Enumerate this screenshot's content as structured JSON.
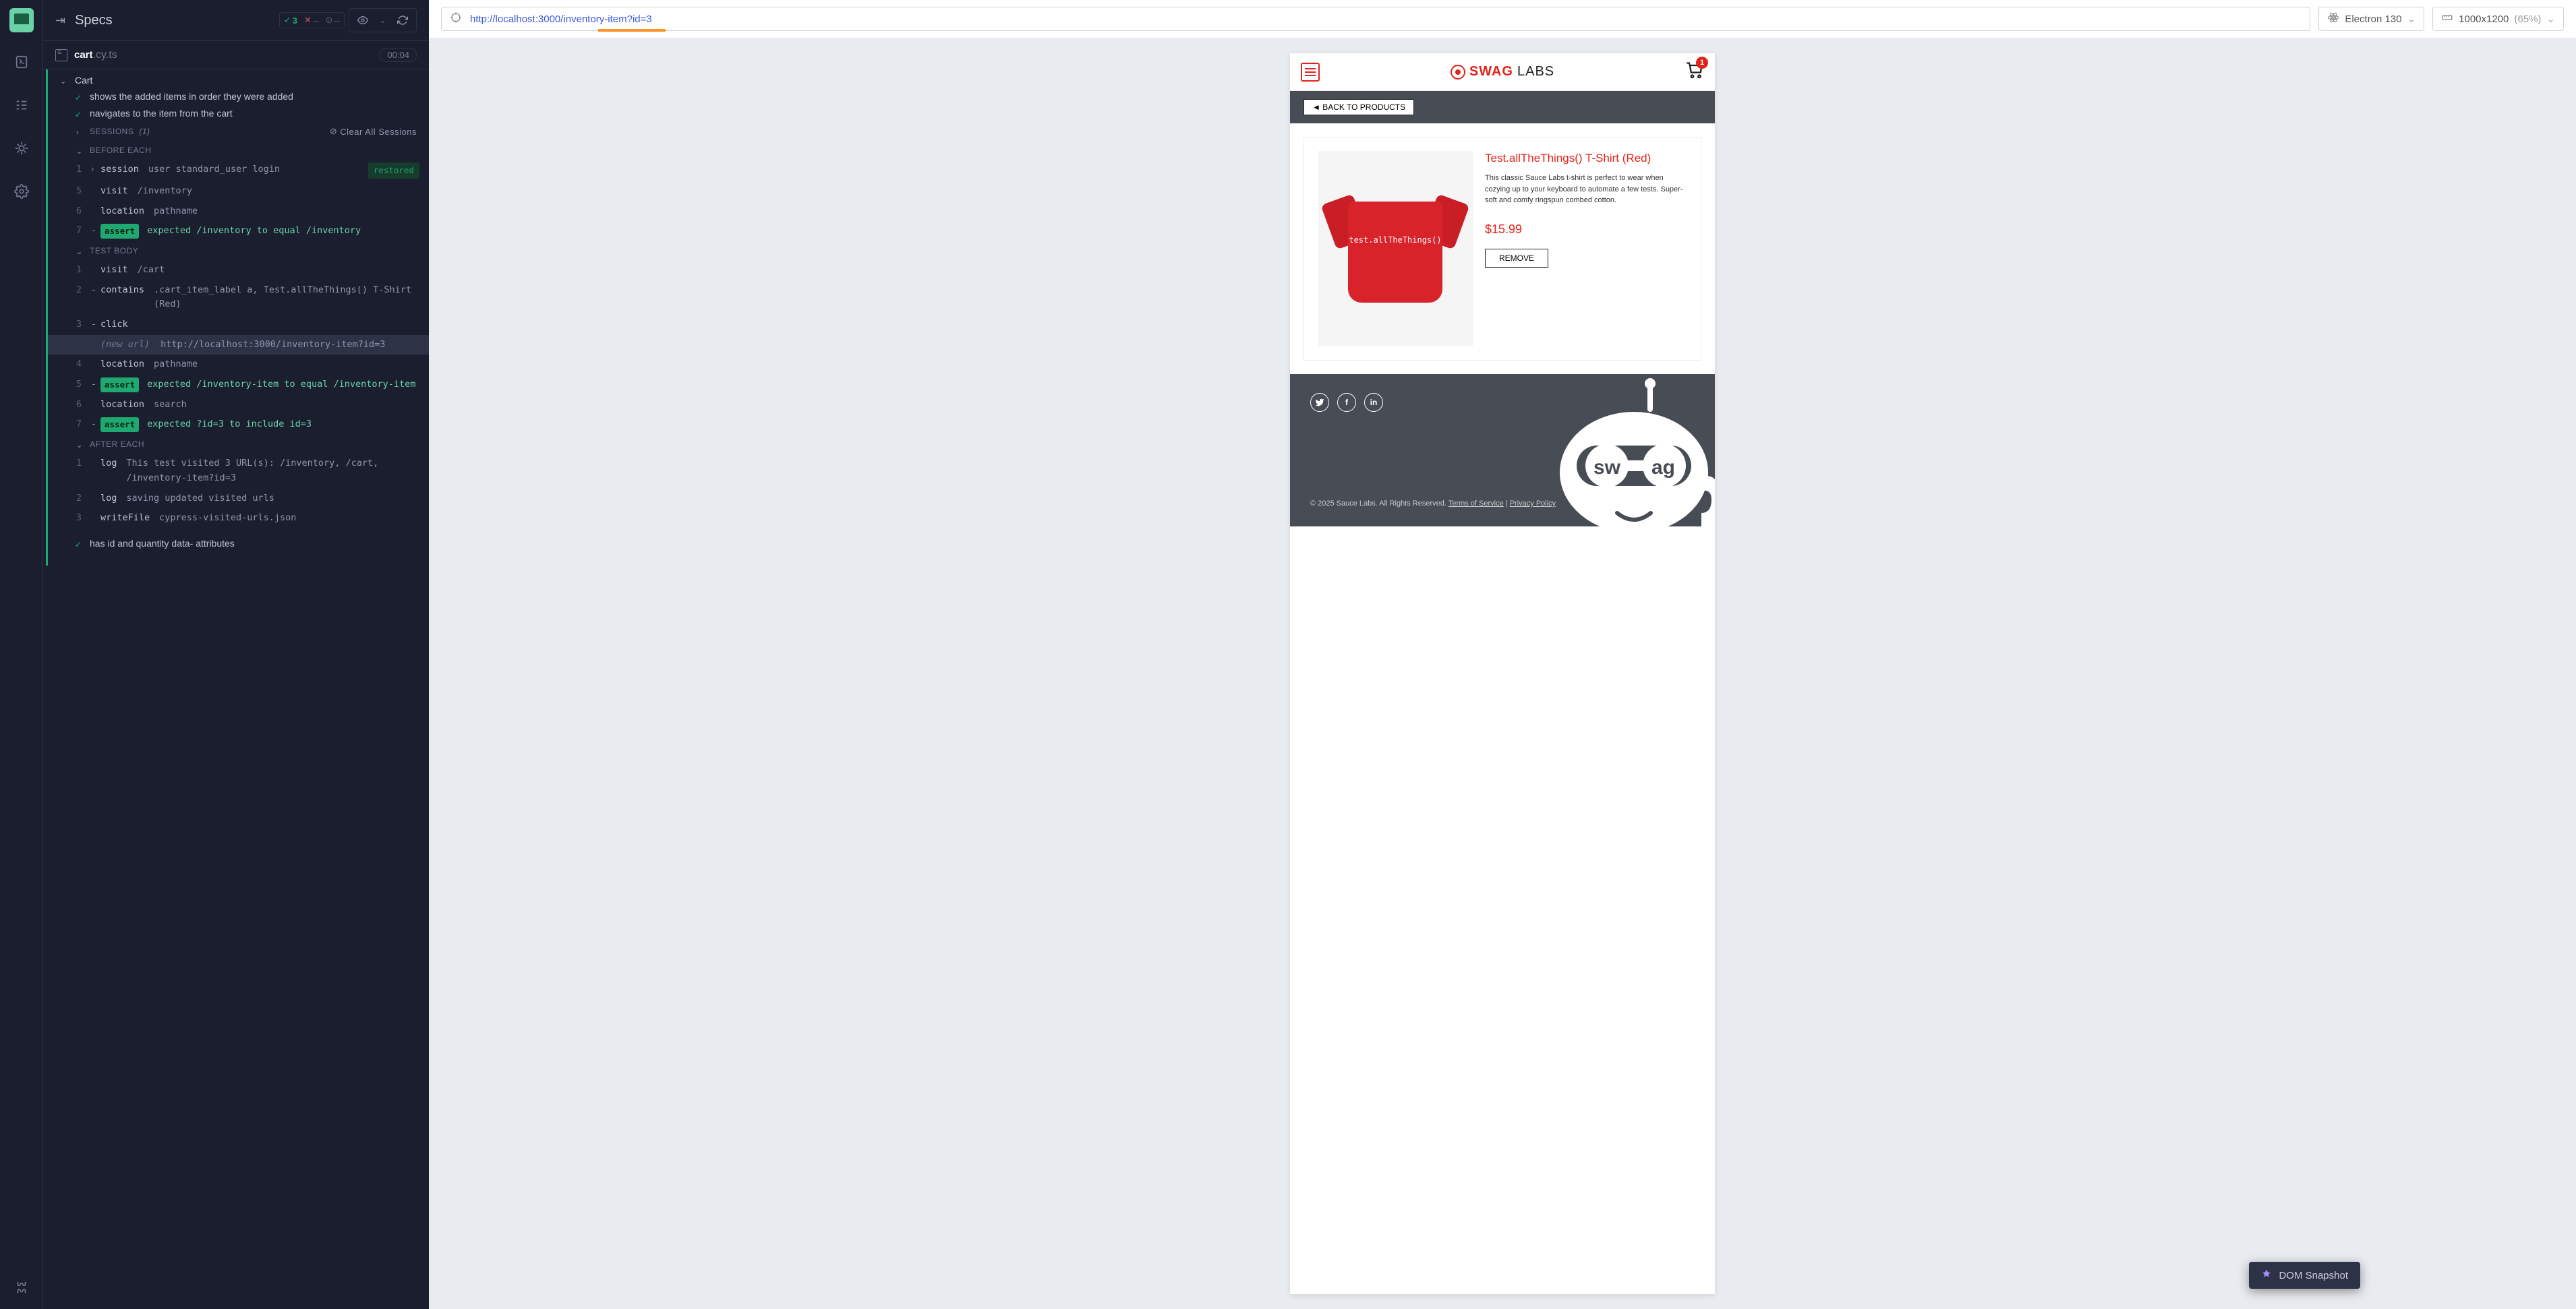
{
  "header": {
    "title": "Specs",
    "pass_count": "3",
    "fail_count": "--",
    "pending": "--"
  },
  "file": {
    "name": "cart",
    "ext": ".cy.ts",
    "duration": "00:04"
  },
  "tree": {
    "suite": "Cart",
    "test1": "shows the added items in order they were added",
    "test2": "navigates to the item from the cart",
    "sessions_label": "SESSIONS",
    "sessions_count": "(1)",
    "clear_sessions": "Clear All Sessions",
    "before_each": "BEFORE EACH",
    "test_body": "TEST BODY",
    "after_each": "AFTER EACH",
    "test3": "has id and quantity data- attributes"
  },
  "cmds": {
    "be1": {
      "n": "1",
      "name": "session",
      "body": "user standard_user login",
      "badge": "restored"
    },
    "be2": {
      "n": "5",
      "name": "visit",
      "body": "/inventory"
    },
    "be3": {
      "n": "6",
      "name": "location",
      "body": "pathname"
    },
    "be4": {
      "n": "7",
      "assert": "assert",
      "body": "expected  /inventory  to equal  /inventory"
    },
    "tb1": {
      "n": "1",
      "name": "visit",
      "body": "/cart"
    },
    "tb2": {
      "n": "2",
      "name": "contains",
      "dash": "-",
      "body": ".cart_item_label a, Test.allTheThings() T-Shirt (Red)"
    },
    "tb3": {
      "n": "3",
      "name": "click",
      "dash": "-"
    },
    "tburl": {
      "label": "(new url)",
      "url": "http://localhost:3000/inventory-item?id=3"
    },
    "tb4": {
      "n": "4",
      "name": "location",
      "body": "pathname"
    },
    "tb5": {
      "n": "5",
      "assert": "assert",
      "body": "expected  /inventory-item  to equal  /inventory-item"
    },
    "tb6": {
      "n": "6",
      "name": "location",
      "body": "search"
    },
    "tb7": {
      "n": "7",
      "assert": "assert",
      "body": "expected  ?id=3  to include  id=3"
    },
    "ae1": {
      "n": "1",
      "name": "log",
      "body": "This test visited 3 URL(s): /inventory, /cart, /inventory-item?id=3"
    },
    "ae2": {
      "n": "2",
      "name": "log",
      "body": "saving updated visited urls"
    },
    "ae3": {
      "n": "3",
      "name": "writeFile",
      "body": "cypress-visited-urls.json"
    }
  },
  "browser": {
    "url_host": "http://localhost:3000",
    "url_path": "/inventory-item?id=3",
    "engine": "Electron 130",
    "viewport": "1000x1200",
    "zoom": "(65%)"
  },
  "swag": {
    "brand1": "SWAG",
    "brand2": "LABS",
    "cart_count": "1",
    "back": "◄  BACK TO PRODUCTS",
    "title": "Test.allTheThings() T-Shirt (Red)",
    "desc": "This classic Sauce Labs t-shirt is perfect to wear when cozying up to your keyboard to automate a few tests. Super-soft and comfy ringspun combed cotton.",
    "price": "$15.99",
    "remove": "REMOVE",
    "tshirt_text": "test.allTheThings()",
    "copyright": "© 2025 Sauce Labs. All Rights Reserved.",
    "tos": "Terms of Service",
    "privacy": "Privacy Policy"
  },
  "snapshot": "DOM Snapshot"
}
